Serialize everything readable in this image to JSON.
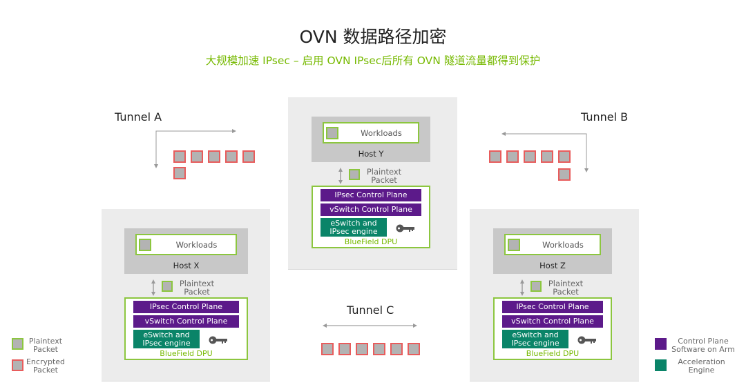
{
  "title": "OVN 数据路径加密",
  "subtitle": "大规模加速 IPsec – 启用 OVN IPsec后所有 OVN 隧道流量都得到保护",
  "colors": {
    "accent_green": "#76b900",
    "plaintext_border": "#8cc63f",
    "encrypted_border": "#e85c5c",
    "control_plane_purple": "#5c1a8a",
    "acceleration_teal": "#0a8468",
    "packet_gray": "#b3b3b3"
  },
  "hosts": [
    {
      "name": "Host X",
      "workloads": "Workloads",
      "plaintext": [
        "Plaintext",
        "Packet"
      ],
      "ipsec_cp": "IPsec Control Plane",
      "vswitch_cp": "vSwitch Control Plane",
      "engine": [
        "eSwitch and",
        "IPsec engine"
      ],
      "dpu": "BlueField DPU",
      "key_icon": "key-icon"
    },
    {
      "name": "Host Y",
      "workloads": "Workloads",
      "plaintext": [
        "Plaintext",
        "Packet"
      ],
      "ipsec_cp": "IPsec Control Plane",
      "vswitch_cp": "vSwitch Control Plane",
      "engine": [
        "eSwitch and",
        "IPsec engine"
      ],
      "dpu": "BlueField DPU",
      "key_icon": "key-icon"
    },
    {
      "name": "Host Z",
      "workloads": "Workloads",
      "plaintext": [
        "Plaintext",
        "Packet"
      ],
      "ipsec_cp": "IPsec Control Plane",
      "vswitch_cp": "vSwitch Control Plane",
      "engine": [
        "eSwitch and",
        "IPsec engine"
      ],
      "dpu": "BlueField DPU",
      "key_icon": "key-icon"
    }
  ],
  "tunnels": [
    {
      "label": "Tunnel A",
      "encrypted_packets": 6
    },
    {
      "label": "Tunnel B",
      "encrypted_packets": 6
    },
    {
      "label": "Tunnel C",
      "encrypted_packets": 6
    }
  ],
  "legend_left": [
    {
      "label": [
        "Plaintext",
        "Packet"
      ],
      "type": "plaintext"
    },
    {
      "label": [
        "Encrypted",
        "Packet"
      ],
      "type": "encrypted"
    }
  ],
  "legend_right": [
    {
      "label": [
        "Control Plane",
        "Software on Arm"
      ],
      "color": "#5c1a8a"
    },
    {
      "label": [
        "Acceleration",
        "Engine"
      ],
      "color": "#0a8468"
    }
  ]
}
